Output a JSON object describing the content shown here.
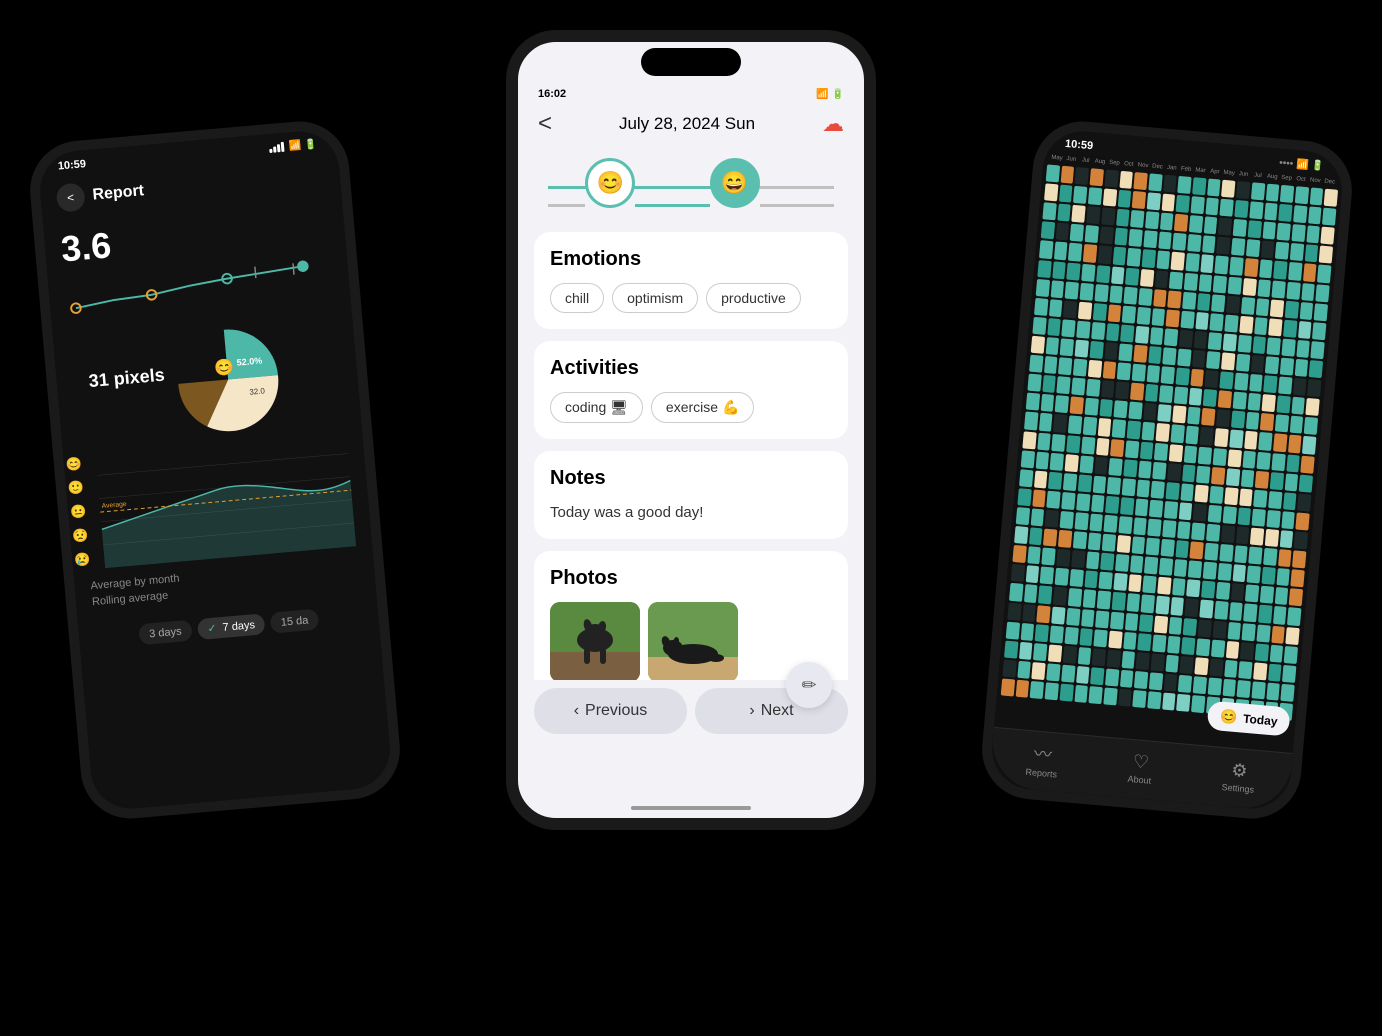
{
  "scene": {
    "background": "#000"
  },
  "leftPhone": {
    "statusBar": {
      "time": "10:59",
      "signal": "wifi"
    },
    "header": {
      "backLabel": "<",
      "title": "Report"
    },
    "stats": {
      "rating": "3.6",
      "pixels": "31 pixels",
      "piePercent1": "52.0%",
      "piePercent2": "32.0"
    },
    "chart": {
      "avgByMonth": "Average by month",
      "rollingAvg": "Rolling average"
    },
    "timePeriods": [
      "3 days",
      "7 days",
      "15 da"
    ]
  },
  "centerPhone": {
    "statusBar": {
      "time": "16:02"
    },
    "nav": {
      "backLabel": "<",
      "title": "July 28, 2024 Sun",
      "cloudIcon": "☁"
    },
    "timeline": {
      "dots": [
        {
          "emoji": "😊",
          "active": false
        },
        {
          "emoji": "😄",
          "active": true
        }
      ]
    },
    "sections": {
      "emotions": {
        "title": "Emotions",
        "tags": [
          "chill",
          "optimism",
          "productive"
        ]
      },
      "activities": {
        "title": "Activities",
        "tags": [
          "coding 🖥",
          "exercise 💪"
        ]
      },
      "notes": {
        "title": "Notes",
        "content": "Today was a good day!"
      },
      "photos": {
        "title": "Photos",
        "count": 2
      }
    },
    "bottomNav": {
      "previousLabel": "Previous",
      "nextLabel": "Next",
      "editIcon": "✏"
    }
  },
  "rightPhone": {
    "statusBar": {
      "time": "10:59"
    },
    "monthLabels": [
      "May",
      "Jun",
      "Jul",
      "Aug",
      "Sep",
      "Oct",
      "Nov",
      "Dec",
      "Jan",
      "Feb",
      "Mar",
      "Apr",
      "May",
      "Jun",
      "Jul",
      "Aug",
      "Sep",
      "Oct",
      "Nov",
      "Dec"
    ],
    "todayBtn": {
      "label": "Today",
      "emoji": "😊"
    },
    "bottomTabs": [
      {
        "icon": "〰",
        "label": "Reports"
      },
      {
        "icon": "♡",
        "label": "About"
      },
      {
        "icon": "⚙",
        "label": "Settings"
      }
    ]
  }
}
